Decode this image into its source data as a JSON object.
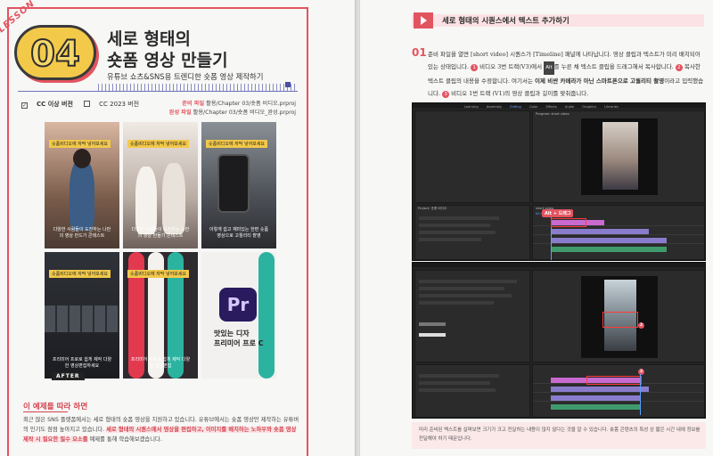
{
  "left": {
    "lesson_label": "LESSON",
    "number": "04",
    "title_line1": "세로 형태의",
    "title_line2": "숏폼 영상 만들기",
    "subtitle": "유튜브 쇼츠&SNS용 트렌디한 숏폼 영상 제작하기",
    "version_cc": "CC 이상 버전",
    "version_2023": "CC 2023 버전",
    "files": {
      "prep_label": "준비 파일",
      "prep_path": "활용/Chapter 03/숏폼 비디오.prproj",
      "done_label": "완성 파일",
      "done_path": "활용/Chapter 03/숏폼 비디오_완성.prproj"
    },
    "thumbs": [
      {
        "caption": "숏폼비디오에 자막 넣어보세요",
        "desc": "다양한 사람들이 도전하는 나만의 영상 만드기 콘테스트"
      },
      {
        "caption": "숏폼비디오에 자막 넣어보세요",
        "desc": "다양한 사람들이 도전하는 나만의 영상 만들기 콘테스트"
      },
      {
        "caption": "숏폼비디오에 자막 넣어보세요",
        "desc": "이렇게 쉽고 재미있는 한편 숏폼 영상으로 고퀄리티 촬영"
      },
      {
        "caption": "숏폼비디오에 자막 넣어보세요",
        "desc": "프리미어 프로로 쉽게 제작 다양한 영상편집하세요"
      },
      {
        "caption": "숏폼비디오에 자막 넣어보세요",
        "desc": "프리미어 프로로 쉽게 제작 다양한 영상편집"
      },
      {
        "caption": "",
        "desc": ""
      }
    ],
    "t6_overlay_line1": "맛있는 디자",
    "t6_overlay_line2": "프리미어 프로 C",
    "pr_logo": "Pr",
    "after_label": "AFTER",
    "section_title": "이 예제를 따라 하면",
    "body_part1": "최근 많은 SNS 플랫폼에서는 세로 형태의 숏폼 영상을 지원하고 있습니다. 유튜브에서는 숏폼 영상만 제작하는 유튜버의 인기도 점점 높아지고 있습니다. ",
    "body_highlight1": "세로 형태의 시퀀스에서 영상을 편집하고, 이미지를 배치하는 노하우와 숏폼 영상 제작 시 필요한 필수 요소를",
    "body_part2": " 예제를 통해 학습해보겠습니다."
  },
  "right": {
    "heading": "세로 형태의 시퀀스에서 텍스트 추가하기",
    "step": "01",
    "p1": "준비 파일을 열면 [short video] 시퀀스가 [Timeline] 패널에 나타납니다. 영상 클립과 텍스트가 미리 배치되어 있는 상태입니다. ",
    "p2": " 비디오 3번 트랙(V3)에서 ",
    "key_alt": "Alt",
    "p3": "를 누른 채 텍스트 클립을 드래그해서 복사합니다. ",
    "p4": " 복사한 텍스트 클립의 내용을 수정합니다. 여기서는 ",
    "p4_em": "이제 비싼 카메라가 아닌 스마트폰으로 고퀄리티 촬영",
    "p5": "이라고 입력했습니다. ",
    "p6": " 비디오 1번 트랙 (V1)의 영상 클립과 길이를 맞춰줍니다.",
    "badges": [
      "1",
      "2",
      "3"
    ],
    "callout_drag": "Alt + 드래그",
    "ui_tabs": [
      "Learning",
      "Assembly",
      "Editing",
      "Color",
      "Effects",
      "Audio",
      "Graphics",
      "Libraries"
    ],
    "panel_project": "Project: 숏폼 비디오",
    "panel_program": "Program: short video",
    "panel_timeline": "short video",
    "timecode": "00;00;00;00",
    "note": "미리 준비된 텍스트를 살펴보면 크기가 크고 전달하는 내용이 많지 않다는 것을 알 수 있습니다. 숏폼 콘텐츠의 특성 상 짧은 시간 내에 정보를 전달해야 하기 때문입니다."
  },
  "colors": {
    "accent_red": "#e2545f",
    "badge_yellow": "#f3c94a",
    "ruler_blue": "#6d73b8"
  }
}
